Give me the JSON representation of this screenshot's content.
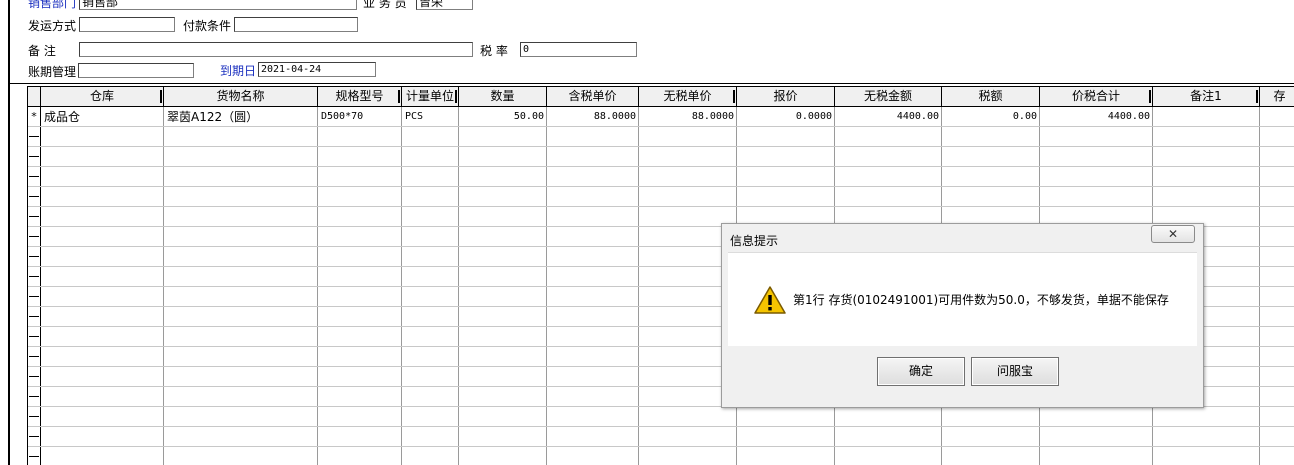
{
  "form": {
    "sales_dept_label": "销售部门",
    "sales_dept_value": "销售部",
    "salesman_label": "业 务 员",
    "salesman_value": "曾荣",
    "ship_method_label": "发运方式",
    "ship_method_value": "",
    "payment_terms_label": "付款条件",
    "payment_terms_value": "",
    "remark_label": "备    注",
    "remark_value": "",
    "tax_rate_label": "税  率",
    "tax_rate_value": "0",
    "account_period_label": "账期管理",
    "account_period_value": "",
    "due_date_label": "到期日",
    "due_date_value": "2021-04-24"
  },
  "grid": {
    "headers": [
      "仓库",
      "货物名称",
      "规格型号",
      "计量单位",
      "数量",
      "含税单价",
      "无税单价",
      "报价",
      "无税金额",
      "税额",
      "价税合计",
      "备注1",
      "存"
    ],
    "rows": [
      {
        "marker": "*",
        "warehouse": "成品仓",
        "goods_name": "翠茵A122（圆）",
        "spec": "D500*70",
        "unit": "PCS",
        "quantity": "50.00",
        "price_incl_tax": "88.0000",
        "price_excl_tax": "88.0000",
        "quote": "0.0000",
        "amount_excl_tax": "4400.00",
        "tax": "0.00",
        "total": "4400.00",
        "remark1": ""
      }
    ]
  },
  "dialog": {
    "title": "信息提示",
    "close_glyph": "✕",
    "icon": "warning-icon",
    "message": "第1行 存货(0102491001)可用件数为50.0，不够发货，单据不能保存",
    "ok_label": "确定",
    "help_label": "问服宝"
  },
  "colors": {
    "label_blue": "#1a2fbf",
    "warning_yellow": "#f5c400",
    "dialog_bg": "#f0f0f0"
  }
}
